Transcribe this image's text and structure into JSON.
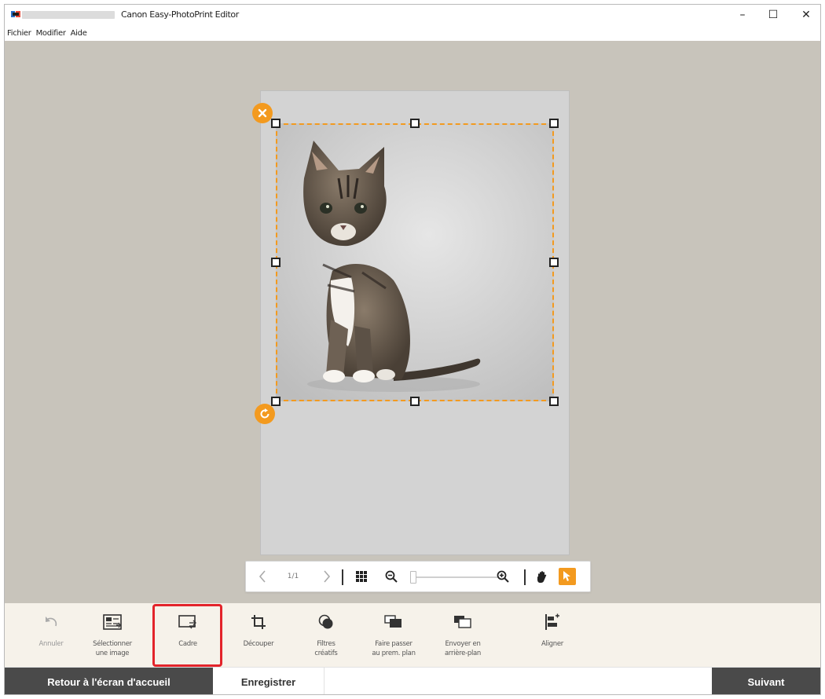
{
  "window": {
    "title": "Canon Easy-PhotoPrint Editor",
    "minimize_glyph": "–",
    "maximize_glyph": "☐",
    "close_glyph": "✕"
  },
  "menu": [
    "Fichier",
    "Modifier",
    "Aide"
  ],
  "navigation": {
    "page_counter": "1/1",
    "icons": [
      "chevron-left-icon",
      "chevron-right-icon",
      "grid-icon",
      "zoom-out-icon",
      "zoom-in-icon",
      "hand-icon",
      "pointer-icon"
    ],
    "zoom_level": 0.03,
    "active_tool": "pointer"
  },
  "tools": [
    {
      "label": "Annuler",
      "icon": "undo-icon",
      "enabled": false
    },
    {
      "label": "Sélectionner\nune image",
      "icon": "select-image-icon",
      "enabled": true
    },
    {
      "label": "Cadre",
      "icon": "frame-icon",
      "enabled": true,
      "highlighted": true
    },
    {
      "label": "Découper",
      "icon": "crop-icon",
      "enabled": true
    },
    {
      "label": "Filtres\ncréatifs",
      "icon": "creative-filters-icon",
      "enabled": true
    },
    {
      "label": "Faire passer\nau prem. plan",
      "icon": "bring-to-front-icon",
      "enabled": true
    },
    {
      "label": "Envoyer en\narrière-plan",
      "icon": "send-to-back-icon",
      "enabled": true
    },
    {
      "label": "Aligner",
      "icon": "align-icon",
      "enabled": true
    }
  ],
  "actions": {
    "home": "Retour à l'écran d'accueil",
    "save": "Enregistrer",
    "next": "Suivant"
  },
  "colors": {
    "accent": "#f39a1f",
    "highlight": "#e3242b",
    "canvas_bg": "#c8c4bb",
    "page_bg": "#d3d3d3",
    "toolbar_bg": "#f6f2ea",
    "dark_button": "#4a4a4a"
  }
}
